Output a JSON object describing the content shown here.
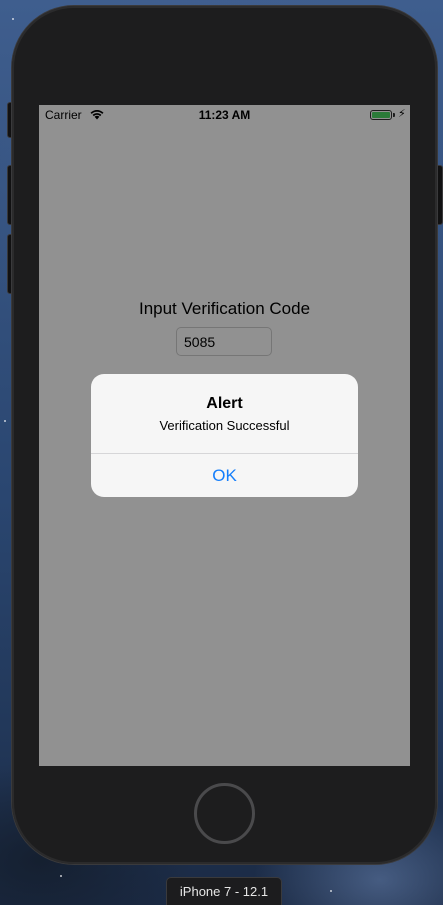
{
  "simulator": {
    "device_label": "iPhone 7 - 12.1"
  },
  "status_bar": {
    "carrier": "Carrier",
    "time": "11:23 AM",
    "battery_icon": "battery-charging-icon",
    "wifi_icon": "wifi-icon",
    "bolt": "⚡"
  },
  "screen": {
    "title": "Input Verification Code",
    "code_value": "5085"
  },
  "alert": {
    "title": "Alert",
    "message": "Verification Successful",
    "ok_label": "OK"
  },
  "colors": {
    "ios_blue": "#147efb",
    "battery_green": "#4cd964",
    "device_body": "#1d1d1e"
  }
}
